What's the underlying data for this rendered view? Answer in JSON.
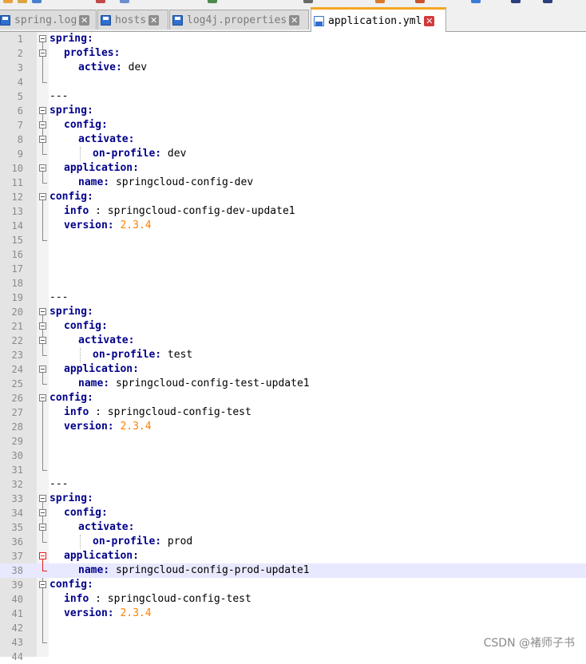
{
  "tabs": [
    {
      "label": "spring.log",
      "active": false
    },
    {
      "label": "hosts",
      "active": false
    },
    {
      "label": "log4j.properties",
      "active": false
    },
    {
      "label": "application.yml",
      "active": true
    }
  ],
  "close_glyph": "✕",
  "editor": {
    "current_line": 38,
    "lines": [
      {
        "n": "1",
        "indent": 0,
        "key": "spring:",
        "val": "",
        "fold": "open"
      },
      {
        "n": "2",
        "indent": 1,
        "key": "profiles:",
        "val": "",
        "fold": "open"
      },
      {
        "n": "3",
        "indent": 2,
        "key": "active:",
        "val": " dev",
        "fold": "mid"
      },
      {
        "n": "4",
        "indent": 0,
        "key": "",
        "val": "",
        "fold": "end"
      },
      {
        "n": "5",
        "indent": 0,
        "key": "",
        "val": "---",
        "fold": ""
      },
      {
        "n": "6",
        "indent": 0,
        "key": "spring:",
        "val": "",
        "fold": "open"
      },
      {
        "n": "7",
        "indent": 1,
        "key": "config:",
        "val": "",
        "fold": "open"
      },
      {
        "n": "8",
        "indent": 2,
        "key": "activate:",
        "val": "",
        "fold": "open"
      },
      {
        "n": "9",
        "indent": 3,
        "key": "on-profile:",
        "val": " dev",
        "fold": "end"
      },
      {
        "n": "10",
        "indent": 1,
        "key": "application:",
        "val": "",
        "fold": "open"
      },
      {
        "n": "11",
        "indent": 2,
        "key": "name:",
        "val": " springcloud-config-dev",
        "fold": "end"
      },
      {
        "n": "12",
        "indent": 0,
        "key": "config:",
        "val": "",
        "fold": "open"
      },
      {
        "n": "13",
        "indent": 1,
        "key": "info",
        "val": " : springcloud-config-dev-update1",
        "fold": "mid"
      },
      {
        "n": "14",
        "indent": 1,
        "key": "version:",
        "val": "",
        "num": " 2.3.4",
        "fold": "mid"
      },
      {
        "n": "15",
        "indent": 0,
        "key": "",
        "val": "",
        "fold": "end"
      },
      {
        "n": "16",
        "indent": 0,
        "key": "",
        "val": "",
        "fold": ""
      },
      {
        "n": "17",
        "indent": 0,
        "key": "",
        "val": "",
        "fold": ""
      },
      {
        "n": "18",
        "indent": 0,
        "key": "",
        "val": "",
        "fold": ""
      },
      {
        "n": "19",
        "indent": 0,
        "key": "",
        "val": "---",
        "fold": ""
      },
      {
        "n": "20",
        "indent": 0,
        "key": "spring:",
        "val": "",
        "fold": "open"
      },
      {
        "n": "21",
        "indent": 1,
        "key": "config:",
        "val": "",
        "fold": "open"
      },
      {
        "n": "22",
        "indent": 2,
        "key": "activate:",
        "val": "",
        "fold": "open"
      },
      {
        "n": "23",
        "indent": 3,
        "key": "on-profile:",
        "val": " test",
        "fold": "end"
      },
      {
        "n": "24",
        "indent": 1,
        "key": "application:",
        "val": "",
        "fold": "open"
      },
      {
        "n": "25",
        "indent": 2,
        "key": "name:",
        "val": " springcloud-config-test-update1",
        "fold": "end"
      },
      {
        "n": "26",
        "indent": 0,
        "key": "config:",
        "val": "",
        "fold": "open"
      },
      {
        "n": "27",
        "indent": 1,
        "key": "info",
        "val": " : springcloud-config-test",
        "fold": "mid"
      },
      {
        "n": "28",
        "indent": 1,
        "key": "version:",
        "val": "",
        "num": " 2.3.4",
        "fold": "mid"
      },
      {
        "n": "29",
        "indent": 0,
        "key": "",
        "val": "",
        "fold": "mid"
      },
      {
        "n": "30",
        "indent": 0,
        "key": "",
        "val": "",
        "fold": "mid"
      },
      {
        "n": "31",
        "indent": 0,
        "key": "",
        "val": "",
        "fold": "end"
      },
      {
        "n": "32",
        "indent": 0,
        "key": "",
        "val": "---",
        "fold": ""
      },
      {
        "n": "33",
        "indent": 0,
        "key": "spring:",
        "val": "",
        "fold": "open"
      },
      {
        "n": "34",
        "indent": 1,
        "key": "config:",
        "val": "",
        "fold": "open"
      },
      {
        "n": "35",
        "indent": 2,
        "key": "activate:",
        "val": "",
        "fold": "open"
      },
      {
        "n": "36",
        "indent": 3,
        "key": "on-profile:",
        "val": " prod",
        "fold": "end"
      },
      {
        "n": "37",
        "indent": 1,
        "key": "application:",
        "val": "",
        "fold": "open-red"
      },
      {
        "n": "38",
        "indent": 2,
        "key": "name:",
        "val": " springcloud-config-prod-update1",
        "fold": "end-red"
      },
      {
        "n": "39",
        "indent": 0,
        "key": "config:",
        "val": "",
        "fold": "open"
      },
      {
        "n": "40",
        "indent": 1,
        "key": "info",
        "val": " : springcloud-config-test",
        "fold": "mid"
      },
      {
        "n": "41",
        "indent": 1,
        "key": "version:",
        "val": "",
        "num": " 2.3.4",
        "fold": "mid"
      },
      {
        "n": "42",
        "indent": 0,
        "key": "",
        "val": "",
        "fold": "mid"
      },
      {
        "n": "43",
        "indent": 0,
        "key": "",
        "val": "",
        "fold": "end"
      },
      {
        "n": "44",
        "indent": 0,
        "key": "",
        "val": "",
        "fold": ""
      }
    ]
  },
  "watermark": "CSDN @褚师子书",
  "colors": {
    "keyword": "#00008b",
    "number": "#ff8000",
    "active_tab_accent": "#f5a623",
    "current_line": "#e8e8ff"
  }
}
